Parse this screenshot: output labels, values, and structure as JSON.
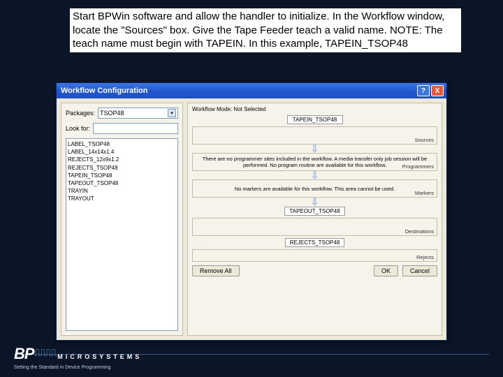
{
  "instructions": "Start BPWin software and allow the handler to initialize. In the Workflow window, locate the \"Sources\" box. Give the Tape Feeder teach a valid name. NOTE: The teach name must begin with TAPEIN. In this example, TAPEIN_TSOP48",
  "window": {
    "title": "Workflow Configuration",
    "help": "?",
    "close": "X"
  },
  "left": {
    "packages_label": "Packages:",
    "packages_value": "TSOP48",
    "lookfor_label": "Look for:",
    "lookfor_value": "",
    "list": [
      "LABEL_TSOP48",
      "LABEL_14x14x1.4",
      "REJECTS_12x9x1.2",
      "REJECTS_TSOP48",
      "TAPEIN_TSOP48",
      "TAPEOUT_TSOP48",
      "TRAYIN",
      "TRAYOUT"
    ]
  },
  "right": {
    "mode_label": "Workflow Mode: Not Selected",
    "source_tag": "TAPEIN_TSOP48",
    "sources_label": "Sources",
    "programmers_msg": "There are no programmer sites included in the workflow. A media transfer only job session will be performed. No program routine are available for this workflow.",
    "programmers_label": "Programmers",
    "markers_msg": "No markers are available for this workflow. This area cannot be used.",
    "markers_label": "Markers",
    "dest_tag": "TAPEOUT_TSOP48",
    "destinations_label": "Destinations",
    "reject_tag": "REJECTS_TSOP48",
    "rejects_label": "Rejects",
    "remove_all": "Remove All",
    "ok": "OK",
    "cancel": "Cancel"
  },
  "footer": {
    "brand_bp": "BP",
    "brand_micro": "MICROSYSTEMS",
    "tagline": "Setting the Standard in Device Programming"
  }
}
